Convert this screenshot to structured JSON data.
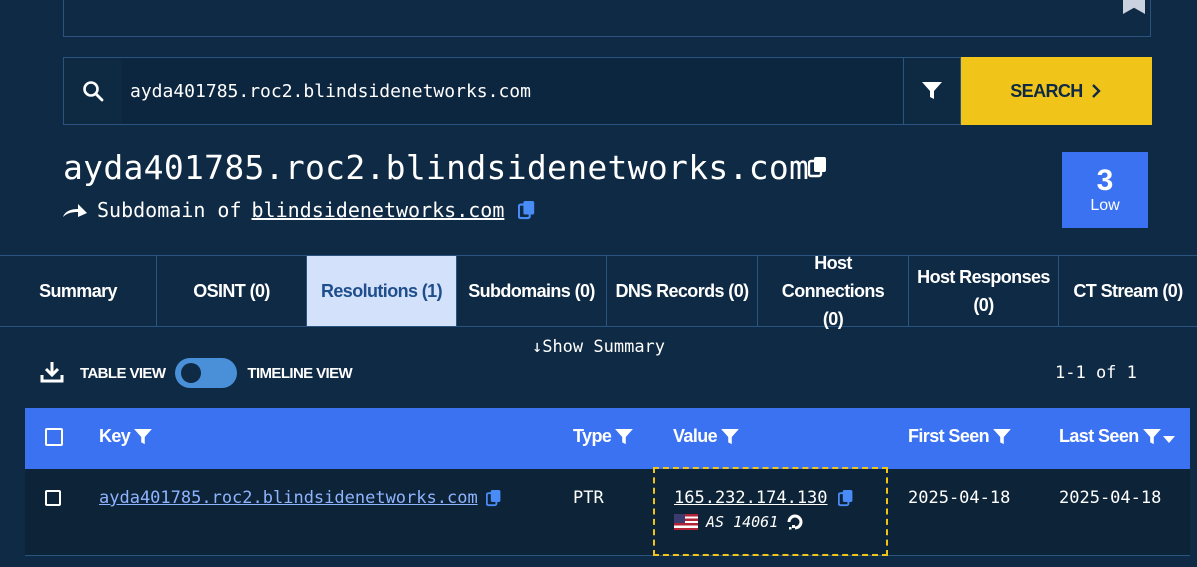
{
  "search": {
    "value": "ayda401785.roc2.blindsidenetworks.com",
    "button_label": "SEARCH"
  },
  "entity": {
    "title": "ayda401785.roc2.blindsidenetworks.com",
    "subdomain_prefix": "Subdomain of",
    "parent_domain": "blindsidenetworks.com",
    "score": "3",
    "score_label": "Low"
  },
  "tabs": [
    {
      "label": "Summary"
    },
    {
      "label": "OSINT (0)"
    },
    {
      "label": "Resolutions (1)"
    },
    {
      "label": "Subdomains (0)"
    },
    {
      "label": "DNS Records (0)"
    },
    {
      "label": "Host Connections (0)"
    },
    {
      "label": "Host Responses (0)"
    },
    {
      "label": "CT Stream (0)"
    }
  ],
  "toolbar": {
    "show_summary": "Show Summary",
    "table_view": "TABLE VIEW",
    "timeline_view": "TIMELINE VIEW",
    "pager": "1-1 of 1"
  },
  "table": {
    "headers": {
      "key": "Key",
      "type": "Type",
      "value": "Value",
      "first_seen": "First Seen",
      "last_seen": "Last Seen"
    },
    "rows": [
      {
        "key": "ayda401785.roc2.blindsidenetworks.com",
        "type": "PTR",
        "value": "165.232.174.130",
        "asn": "AS 14061",
        "first_seen": "2025-04-18",
        "last_seen": "2025-04-18"
      }
    ]
  },
  "colors": {
    "background": "#0f2a44",
    "accent": "#3b72f2",
    "search_button": "#f0c419",
    "active_tab": "#d4e1fb"
  }
}
